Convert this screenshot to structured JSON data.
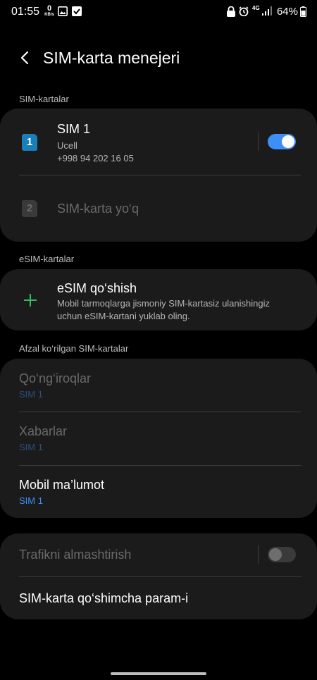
{
  "status": {
    "time": "01:55",
    "net_speed": "0",
    "net_unit": "KB/s",
    "network": "4G",
    "battery": "64%"
  },
  "header": {
    "title": "SIM-karta menejeri"
  },
  "sections": {
    "sim_cards": "SIM-kartalar",
    "esim_cards": "eSIM-kartalar",
    "preferred": "Afzal ko‘rilgan SIM-kartalar"
  },
  "sim1": {
    "badge": "1",
    "name": "SIM 1",
    "carrier": "Ucell",
    "number": "+998 94 202 16 05",
    "enabled": true
  },
  "sim2": {
    "badge": "2",
    "label": "SIM-karta yo‘q"
  },
  "esim": {
    "title": "eSIM qo‘shish",
    "desc_line1": "Mobil tarmoqlarga jismoniy SIM-kartasiz ulanishingiz",
    "desc_line2": "uchun eSIM-kartani yuklab oling."
  },
  "preferred": {
    "calls": {
      "label": "Qo‘ng‘iroqlar",
      "value": "SIM 1"
    },
    "messages": {
      "label": "Xabarlar",
      "value": "SIM 1"
    },
    "mobile_data": {
      "label": "Mobil ma’lumot",
      "value": "SIM 1"
    }
  },
  "extra": {
    "traffic_switch": "Trafikni almashtirish",
    "traffic_switch_enabled": false,
    "more_settings": "SIM-karta qo‘shimcha param-i"
  },
  "colors": {
    "accent": "#3e8ef7",
    "sim_blue": "#1a7fb8",
    "add_green": "#2fbf5a",
    "card_bg": "#1b1b1b"
  }
}
